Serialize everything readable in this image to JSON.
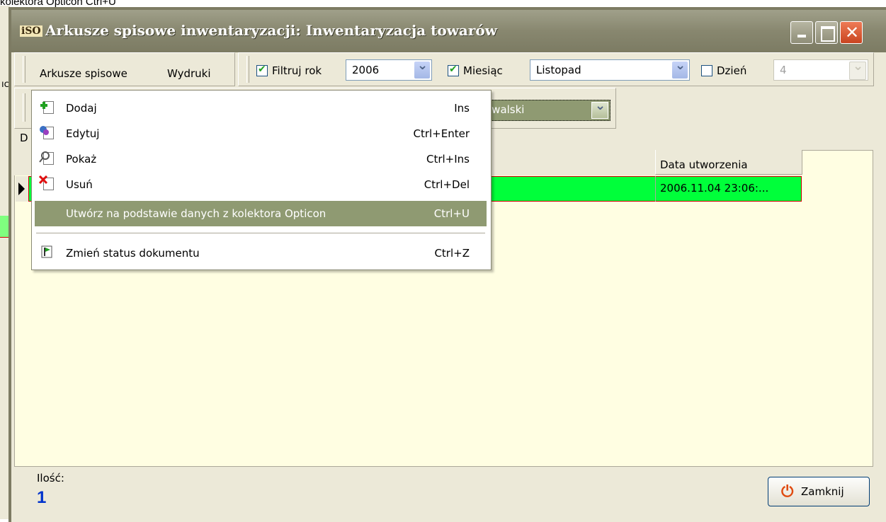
{
  "caption": "kolektora Opticon Ctrl+U",
  "background": {
    "fragment": "ıc"
  },
  "window": {
    "app_icon": "iSO",
    "title": "Arkusze spisowe inwentaryzacji: Inwentaryzacja towarów",
    "controls": {
      "close": "✕"
    }
  },
  "menubar": {
    "items": [
      "Arkusze spisowe",
      "Wydruki"
    ]
  },
  "filters": {
    "year": {
      "label": "Filtruj rok",
      "checked": true,
      "value": "2006"
    },
    "month": {
      "label": "Miesiąc",
      "checked": true,
      "value": "Listopad"
    },
    "day": {
      "label": "Dzień",
      "checked": false,
      "value": "4"
    }
  },
  "row2": {
    "user_value": "owalski",
    "label_fragment": "D"
  },
  "grid": {
    "columns": [
      "Data utworzenia"
    ],
    "rows": [
      {
        "date": "2006.11.04 23:06:..."
      }
    ]
  },
  "context_menu": {
    "items": [
      {
        "label": "Dodaj",
        "shortcut": "Ins",
        "icon": "add-document-icon"
      },
      {
        "label": "Edytuj",
        "shortcut": "Ctrl+Enter",
        "icon": "edit-document-icon"
      },
      {
        "label": "Pokaż",
        "shortcut": "Ctrl+Ins",
        "icon": "view-document-icon"
      },
      {
        "label": "Usuń",
        "shortcut": "Ctrl+Del",
        "icon": "delete-document-icon"
      },
      {
        "label": "Utwórz na podstawie danych z kolektora Opticon",
        "shortcut": "Ctrl+U",
        "highlighted": true
      },
      {
        "label": "Zmień status dokumentu",
        "shortcut": "Ctrl+Z",
        "icon": "flag-document-icon"
      }
    ]
  },
  "footer": {
    "count_label": "Ilość:",
    "count_value": "1",
    "close_button": "Zamknij"
  },
  "colors": {
    "titlebar": "#88876f",
    "highlight": "#8f9a72",
    "row_green": "#00ff3a",
    "grid_bg": "#fffee2"
  }
}
